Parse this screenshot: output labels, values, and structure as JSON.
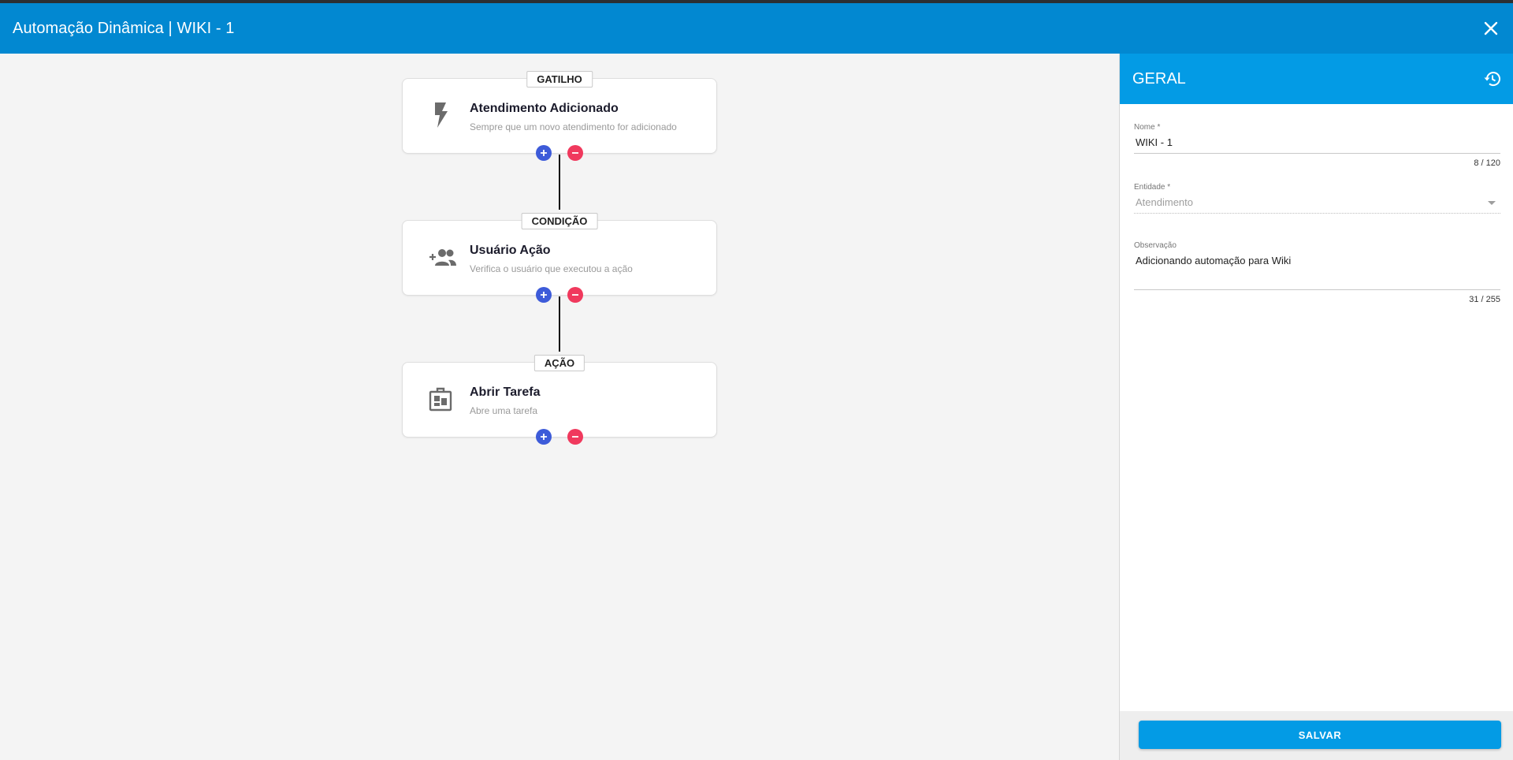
{
  "window": {
    "title": "Automação Dinâmica | WIKI - 1"
  },
  "flow": {
    "nodes": [
      {
        "badge": "GATILHO",
        "icon": "lightning-bolt-icon",
        "title": "Atendimento Adicionado",
        "subtitle": "Sempre que um novo atendimento for adicionado"
      },
      {
        "badge": "CONDIÇÃO",
        "icon": "add-user-group-icon",
        "title": "Usuário Ação",
        "subtitle": "Verifica o usuário que executou a ação"
      },
      {
        "badge": "AÇÃO",
        "icon": "task-board-icon",
        "title": "Abrir Tarefa",
        "subtitle": "Abre uma tarefa"
      }
    ]
  },
  "panel": {
    "title": "GERAL",
    "fields": {
      "nome": {
        "label": "Nome *",
        "value": "WIKI - 1",
        "counter": "8 / 120"
      },
      "entidade": {
        "label": "Entidade *",
        "value": "Atendimento"
      },
      "observacao": {
        "label": "Observação",
        "value": "Adicionando automação para Wiki",
        "counter": "31 / 255"
      }
    },
    "save_label": "SALVAR"
  },
  "colors": {
    "topbar": "#0288d1",
    "panel_header": "#039be5",
    "add_button": "#3d5bd9",
    "remove_button": "#f0395d"
  }
}
